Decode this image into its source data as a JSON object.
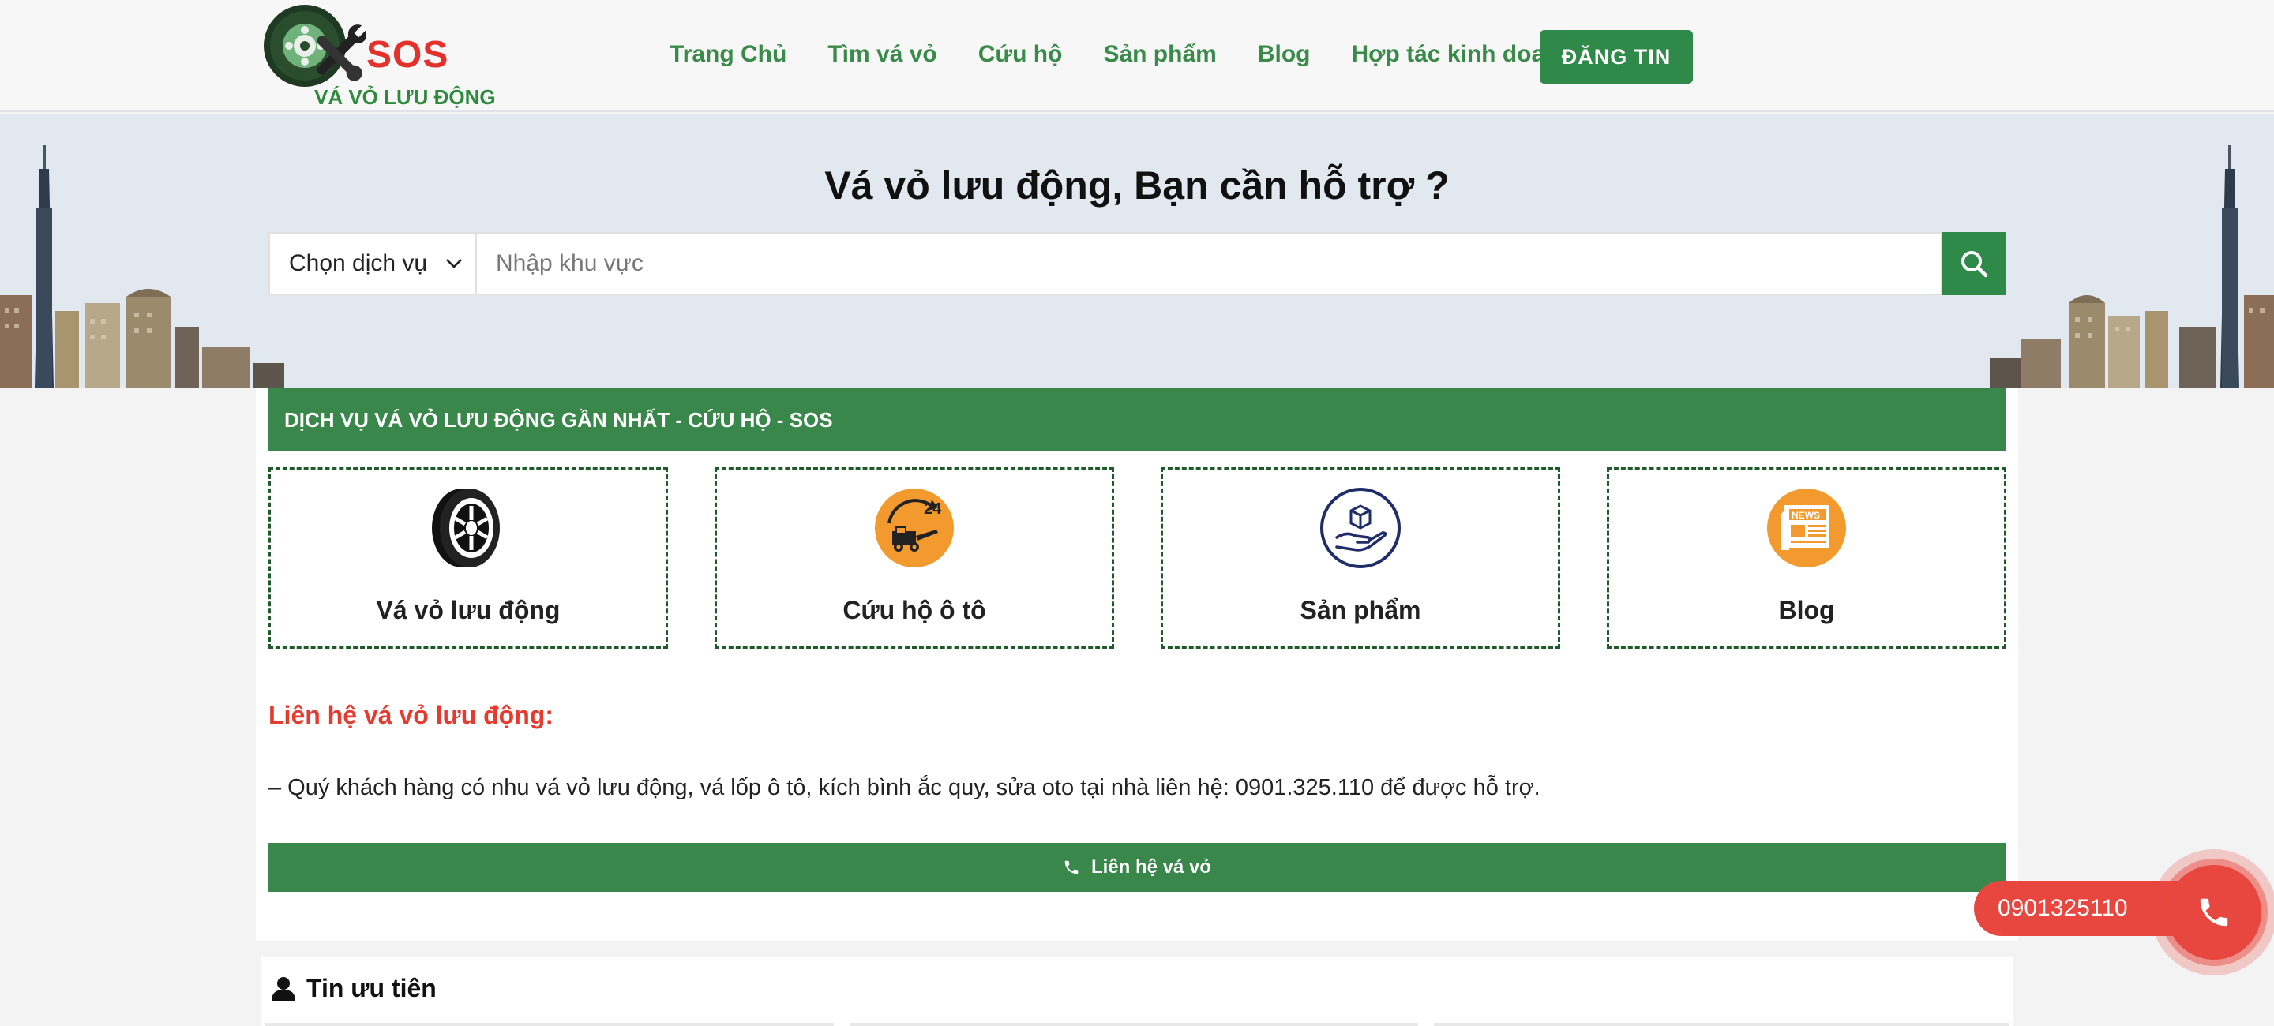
{
  "header": {
    "logo": {
      "brand": "SOS",
      "subtitle": "VÁ VỎ LƯU ĐỘNG"
    },
    "nav": [
      {
        "label": "Trang Chủ"
      },
      {
        "label": "Tìm vá vỏ"
      },
      {
        "label": "Cứu hộ"
      },
      {
        "label": "Sản phẩm"
      },
      {
        "label": "Blog"
      },
      {
        "label": "Hợp tác kinh doanh"
      }
    ],
    "register_label": "ĐĂNG TIN"
  },
  "hero": {
    "title": "Vá vỏ lưu động, Bạn cần hỗ trợ ?",
    "select_value": "Chọn dịch vụ",
    "search_placeholder": "Nhập khu vực"
  },
  "main": {
    "band_title": "DỊCH VỤ VÁ VỎ LƯU ĐỘNG GẦN NHẤT - CỨU HỘ - SOS",
    "services": [
      {
        "label": "Vá vỏ lưu động",
        "icon": "tire-icon"
      },
      {
        "label": "Cứu hộ ô tô",
        "icon": "tow-truck-24-icon",
        "badge": "24"
      },
      {
        "label": "Sản phẩm",
        "icon": "product-box-hand-icon"
      },
      {
        "label": "Blog",
        "icon": "newspaper-icon",
        "badge": "NEWS"
      }
    ],
    "contact_title": "Liên hệ vá vỏ lưu động:",
    "contact_text": "– Quý khách hàng có nhu vá vỏ lưu động, vá lốp ô tô, kích bình ắc quy, sửa oto tại nhà liên hệ: 0901.325.110 để được hỗ trợ.",
    "contact_button": "Liên hệ vá vỏ"
  },
  "priority": {
    "title": "Tin ưu tiên"
  },
  "call_float": {
    "phone": "0901325110"
  },
  "colors": {
    "brand_green": "#2f8a4a",
    "band_green": "#3a874b",
    "accent_red": "#e8473f",
    "logo_red": "#e4312b",
    "service_orange": "#f29a2e",
    "service_navy": "#1f2d6b"
  }
}
